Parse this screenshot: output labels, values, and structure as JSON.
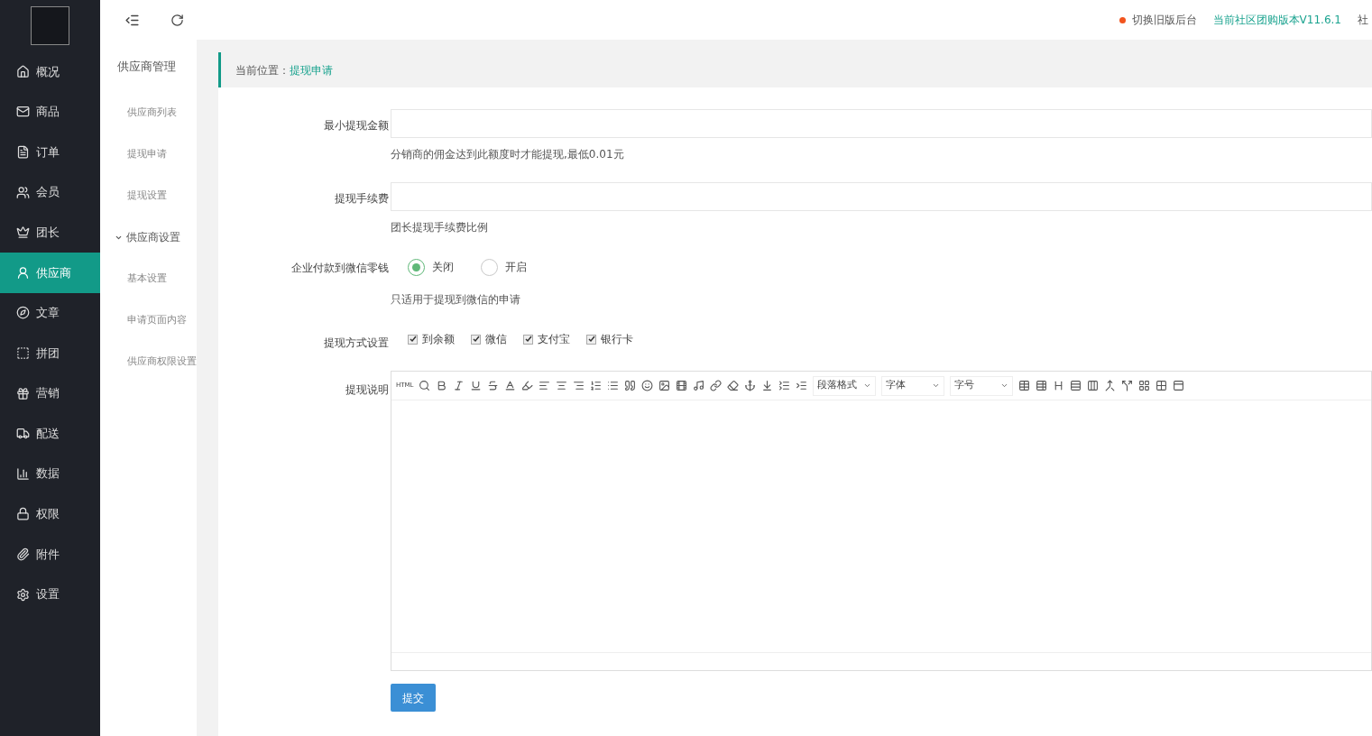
{
  "nav": [
    {
      "label": "概况",
      "selected": false
    },
    {
      "label": "商品",
      "selected": false
    },
    {
      "label": "订单",
      "selected": false
    },
    {
      "label": "会员",
      "selected": false
    },
    {
      "label": "团长",
      "selected": false
    },
    {
      "label": "供应商",
      "selected": true
    },
    {
      "label": "文章",
      "selected": false
    },
    {
      "label": "拼团",
      "selected": false
    },
    {
      "label": "营销",
      "selected": false
    },
    {
      "label": "配送",
      "selected": false
    },
    {
      "label": "数据",
      "selected": false
    },
    {
      "label": "权限",
      "selected": false
    },
    {
      "label": "附件",
      "selected": false
    },
    {
      "label": "设置",
      "selected": false
    }
  ],
  "submenu": {
    "title": "供应商管理",
    "items": [
      {
        "label": "供应商列表"
      },
      {
        "label": "提现申请"
      },
      {
        "label": "提现设置"
      },
      {
        "label": "供应商设置",
        "expanded": true,
        "children": [
          {
            "label": "基本设置"
          },
          {
            "label": "申请页面内容"
          },
          {
            "label": "供应商权限设置"
          }
        ]
      }
    ]
  },
  "topbar": {
    "switch_link": "切换旧版后台",
    "version": "当前社区团购版本V11.6.1",
    "cut_text": "社"
  },
  "breadcrumb": {
    "label": "当前位置：",
    "current": "提现申请"
  },
  "form": [
    {
      "kind": "input",
      "label": "最小提现金额",
      "help": "分销商的佣金达到此额度时才能提现,最低0.01元"
    },
    {
      "kind": "input",
      "label": "提现手续费",
      "help": "团长提现手续费比例"
    },
    {
      "kind": "radio",
      "label": "企业付款到微信零钱",
      "options": [
        {
          "label": "关闭",
          "selected": true
        },
        {
          "label": "开启",
          "selected": false
        }
      ],
      "help": "只适用于提现到微信的申请"
    },
    {
      "kind": "checkbox",
      "label": "提现方式设置",
      "options": [
        {
          "label": "到余额",
          "checked": true
        },
        {
          "label": "微信",
          "checked": true
        },
        {
          "label": "支付宝",
          "checked": true
        },
        {
          "label": "银行卡",
          "checked": true
        }
      ]
    },
    {
      "kind": "editor",
      "label": "提现说明",
      "html_button": "HTML",
      "selects": [
        "段落格式",
        "字体",
        "字号"
      ]
    }
  ],
  "submit": "提交"
}
